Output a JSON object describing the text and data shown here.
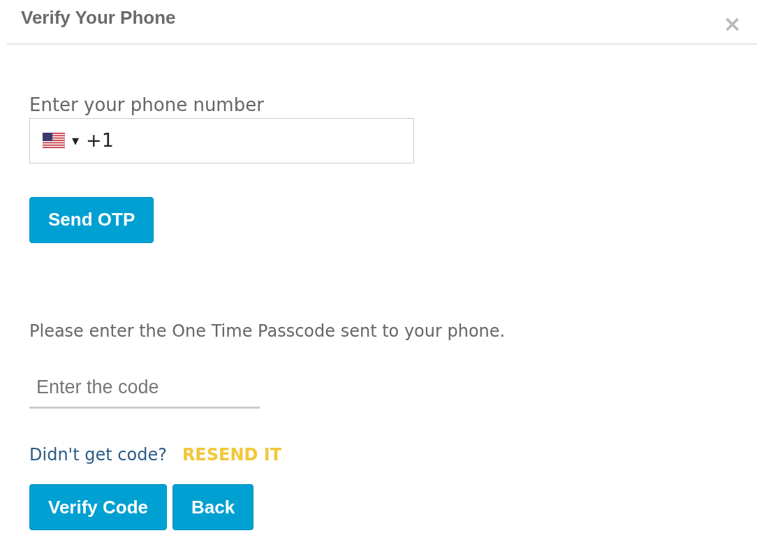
{
  "dialog": {
    "title": "Verify Your Phone",
    "close": "×"
  },
  "phone": {
    "label": "Enter your phone number",
    "value": "+1",
    "caret": "▾"
  },
  "send_button": "Send OTP",
  "instruction": "Please enter the One Time Passcode sent to your phone.",
  "code": {
    "placeholder": "Enter the code"
  },
  "resend": {
    "text": "Didn't get code?",
    "link": "RESEND IT"
  },
  "buttons": [
    "Verify Code",
    "Back"
  ]
}
